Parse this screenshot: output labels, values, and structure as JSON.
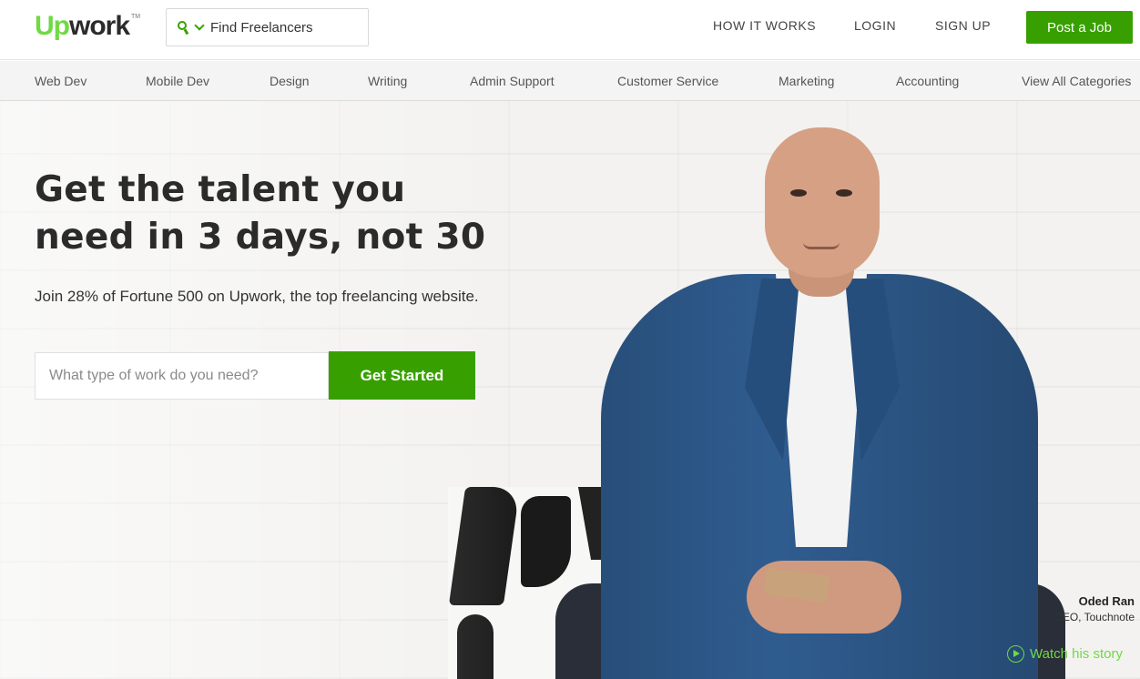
{
  "header": {
    "logo_up": "Up",
    "logo_work": "work",
    "logo_tm": "TM",
    "search_dropdown_label": "Find Freelancers",
    "nav": [
      "HOW IT WORKS",
      "LOGIN",
      "SIGN UP"
    ],
    "post_job_label": "Post a Job"
  },
  "categories": [
    "Web Dev",
    "Mobile Dev",
    "Design",
    "Writing",
    "Admin Support",
    "Customer Service",
    "Marketing",
    "Accounting",
    "View All Categories"
  ],
  "hero": {
    "headline_line1": "Get the talent you",
    "headline_line2": "need in 3 days, not 30",
    "subtext": "Join 28% of Fortune 500 on Upwork, the top freelancing website.",
    "search_placeholder": "What type of work do you need?",
    "cta_label": "Get Started"
  },
  "testimonial": {
    "name": "Oded Ran",
    "role": "CEO, Touchnote",
    "watch_label": "Watch his story"
  },
  "colors": {
    "brand_green": "#37a000",
    "logo_green": "#6fda44",
    "jacket_blue": "#2f5c8f"
  },
  "icons": {
    "search": "search-icon",
    "dropdown": "chevron-down-icon",
    "play": "play-circle-icon"
  }
}
